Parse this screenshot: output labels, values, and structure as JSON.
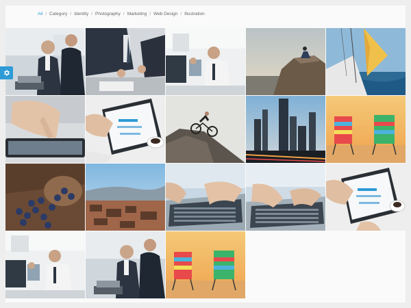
{
  "filters": {
    "items": [
      "All",
      "Category",
      "Identity",
      "Photography",
      "Marketing",
      "Web Design",
      "Illustration"
    ],
    "separator": "/",
    "active": "All"
  },
  "colors": {
    "accent": "#2e9bd6",
    "page_bg": "#eeeeee",
    "panel_bg": "#fafafa"
  },
  "gallery": {
    "photos": [
      {
        "subject": "businessmen-laptop"
      },
      {
        "subject": "business-meeting-documents"
      },
      {
        "subject": "office-computer-workers"
      },
      {
        "subject": "man-on-rock-sunset"
      },
      {
        "subject": "sailboat-sea"
      },
      {
        "subject": "hand-tablet-touch"
      },
      {
        "subject": "tablet-chart-coffee"
      },
      {
        "subject": "mountain-biker-rock"
      },
      {
        "subject": "city-skyline-night"
      },
      {
        "subject": "beach-chairs-sunset"
      },
      {
        "subject": "blueberries-bowl"
      },
      {
        "subject": "desert-rocks-landscape"
      },
      {
        "subject": "hands-laptop-typing"
      },
      {
        "subject": "hands-laptop-keyboard"
      },
      {
        "subject": "tablet-chart-coffee"
      },
      {
        "subject": "office-computer-workers"
      },
      {
        "subject": "businessmen-laptop"
      },
      {
        "subject": "beach-chairs-sunset"
      }
    ]
  },
  "settings": {
    "icon": "gear-icon"
  }
}
